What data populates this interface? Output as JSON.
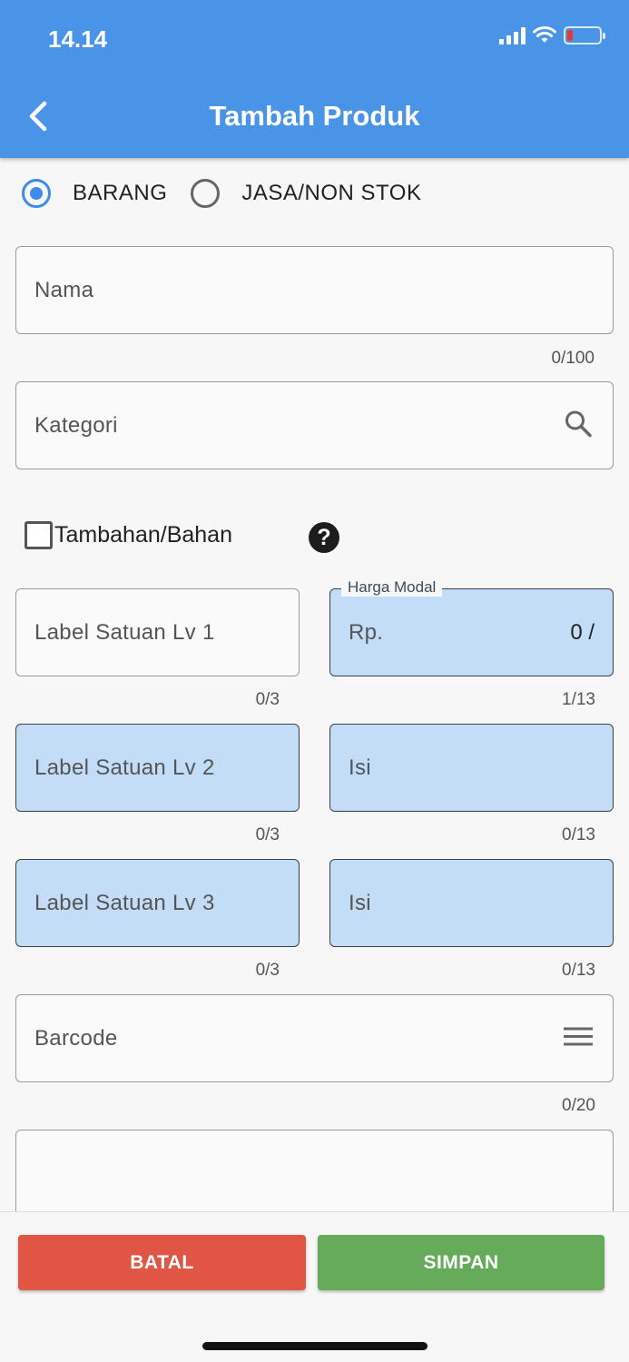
{
  "status_bar": {
    "time": "14.14",
    "icons": [
      "signal-icon",
      "wifi-icon",
      "battery-low-icon"
    ]
  },
  "appbar": {
    "title": "Tambah Produk",
    "back_icon": "chevron-left-icon",
    "color": "#4a94e8"
  },
  "product_type": {
    "options": [
      {
        "label": "BARANG",
        "selected": true
      },
      {
        "label": "JASA/NON STOK",
        "selected": false
      }
    ]
  },
  "fields": {
    "nama": {
      "placeholder": "Nama",
      "counter": "0/100"
    },
    "kategori": {
      "placeholder": "Kategori",
      "icon": "search-icon"
    },
    "tambahan": {
      "label": "Tambahan/Bahan",
      "checked": false,
      "help_icon": "question-icon"
    },
    "label_satuan_1": {
      "placeholder": "Label Satuan Lv 1",
      "counter": "0/3"
    },
    "harga_modal": {
      "label": "Harga Modal",
      "prefix": "Rp.",
      "value": "0 /",
      "counter": "1/13"
    },
    "label_satuan_2": {
      "placeholder": "Label Satuan Lv 2",
      "counter": "0/3"
    },
    "isi_2": {
      "placeholder": "Isi",
      "counter": "0/13"
    },
    "label_satuan_3": {
      "placeholder": "Label Satuan Lv 3",
      "counter": "0/3"
    },
    "isi_3": {
      "placeholder": "Isi",
      "counter": "0/13"
    },
    "barcode": {
      "placeholder": "Barcode",
      "counter": "0/20",
      "icon": "menu-lines-icon"
    }
  },
  "actions": {
    "cancel_label": "BATAL",
    "save_label": "SIMPAN",
    "cancel_color": "#e05543",
    "save_color": "#66ab5a"
  }
}
